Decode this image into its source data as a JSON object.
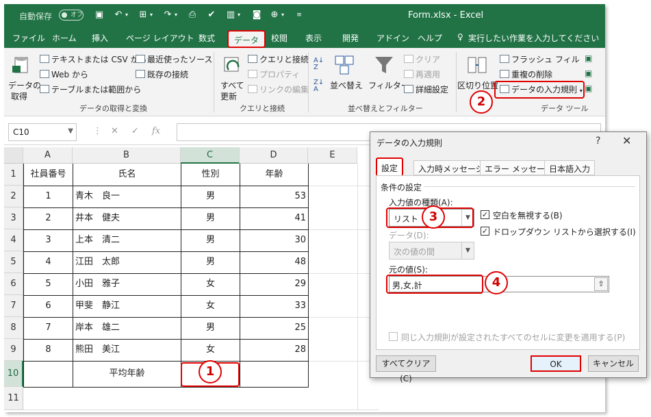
{
  "titlebar": {
    "autosave_label": "自動保存",
    "autosave_state": "オフ",
    "doc_title": "Form.xlsx",
    "app_name": "Excel"
  },
  "tabs": [
    "ファイル",
    "ホーム",
    "挿入",
    "ページ レイアウト",
    "数式",
    "データ",
    "校閲",
    "表示",
    "開発",
    "アドイン",
    "ヘルプ"
  ],
  "tell_me": "実行したい作業を入力してください",
  "ribbon": {
    "get_data": "データの",
    "get_data_2": "取得",
    "from_text": "テキストまたは CSV から",
    "from_web": "Web から",
    "from_table": "テーブルまたは範囲から",
    "recent_sources": "最近使ったソース",
    "existing_conn": "既存の接続",
    "group_get": "データの取得と変換",
    "refresh_all": "すべて",
    "refresh_all_2": "更新",
    "queries_conn": "クエリと接続",
    "properties": "プロパティ",
    "edit_links": "リンクの編集",
    "group_queries": "クエリと接続",
    "sort": "並べ替え",
    "filter": "フィルター",
    "clear": "クリア",
    "reapply": "再適用",
    "advanced": "詳細設定",
    "group_sort": "並べ替えとフィルター",
    "text_to_columns": "区切り位置",
    "flash_fill": "フラッシュ フィル",
    "remove_dup": "重複の削除",
    "data_validation": "データの入力規則",
    "group_tools": "データ ツール"
  },
  "formula_bar": {
    "name_box": "C10",
    "fx": "fx"
  },
  "sheet": {
    "columns": [
      "A",
      "B",
      "C",
      "D",
      "E"
    ],
    "rows": [
      "1",
      "2",
      "3",
      "4",
      "5",
      "6",
      "7",
      "8",
      "9",
      "10",
      "11"
    ],
    "header": [
      "社員番号",
      "氏名",
      "性別",
      "年齢"
    ],
    "data": [
      [
        "1",
        "青木　良一",
        "男",
        "53"
      ],
      [
        "2",
        "井本　健夫",
        "男",
        "41"
      ],
      [
        "3",
        "上本　清二",
        "男",
        "30"
      ],
      [
        "4",
        "江田　太郎",
        "男",
        "48"
      ],
      [
        "5",
        "小田　雅子",
        "女",
        "29"
      ],
      [
        "6",
        "甲斐　静江",
        "女",
        "33"
      ],
      [
        "7",
        "岸本　雄二",
        "男",
        "25"
      ],
      [
        "8",
        "熊田　美江",
        "女",
        "28"
      ]
    ],
    "avg_label": "平均年齢"
  },
  "dialog": {
    "title": "データの入力規則",
    "help": "?",
    "close": "✕",
    "tabs": [
      "設定",
      "入力時メッセージ",
      "エラー メッセージ",
      "日本語入力"
    ],
    "section": "条件の設定",
    "allow_label": "入力値の種類(A):",
    "allow_value": "リスト",
    "ignore_blank": "空白を無視する(B)",
    "in_cell_dropdown": "ドロップダウン リストから選択する(I)",
    "data_label": "データ(D):",
    "data_value": "次の値の間",
    "source_label": "元の値(S):",
    "source_value": "男,女,計",
    "apply_all": "同じ入力規則が設定されたすべてのセルに変更を適用する(P)",
    "clear_all": "すべてクリア(C)",
    "ok": "OK",
    "cancel": "キャンセル"
  },
  "callouts": [
    "1",
    "2",
    "3",
    "4"
  ],
  "colors": {
    "excel_green": "#217346",
    "highlight_red": "#e00000"
  }
}
